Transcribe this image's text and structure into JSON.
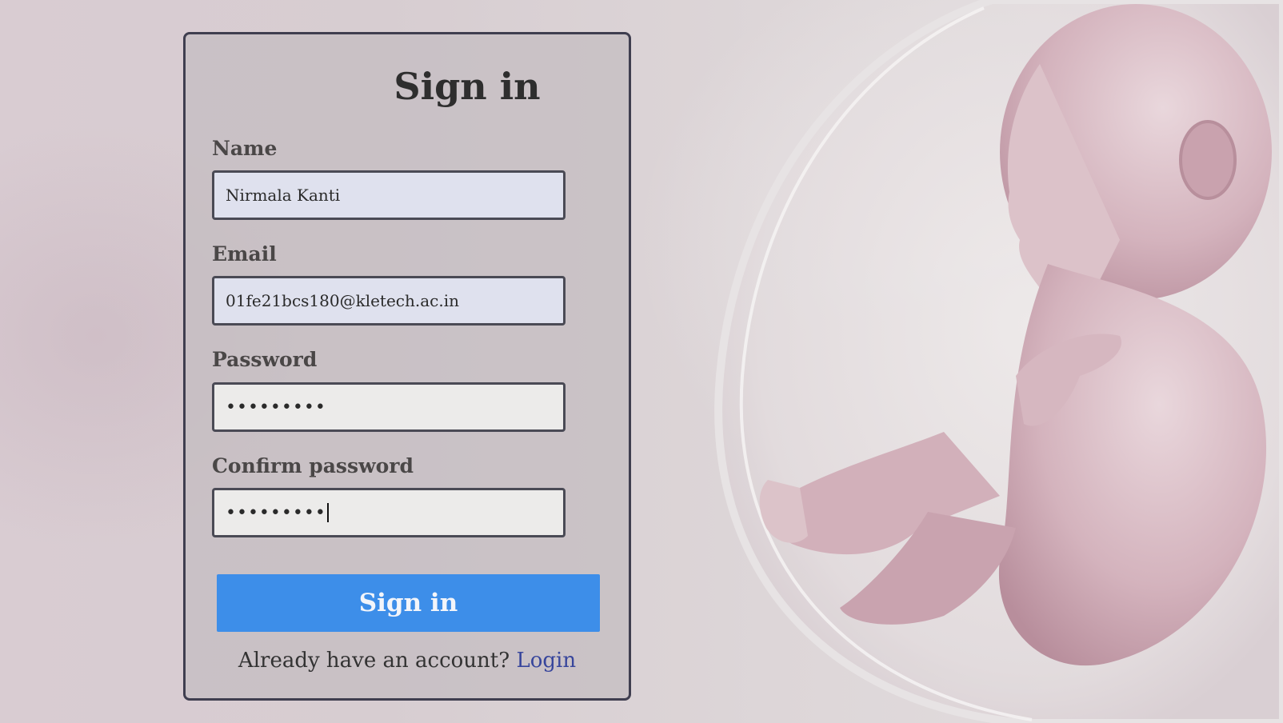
{
  "form": {
    "title": "Sign in",
    "name_label": "Name",
    "name_value": "Nirmala Kanti",
    "email_label": "Email",
    "email_value": "01fe21bcs180@kletech.ac.in",
    "password_label": "Password",
    "password_value": "•••••••••",
    "confirm_label": "Confirm password",
    "confirm_value": "•••••••••",
    "submit_label": "Sign in",
    "footer_text": "Already have an account?",
    "footer_link": "Login"
  },
  "colors": {
    "button": "#3d8ee9",
    "link": "#38469c",
    "card_border": "#3f3e4f"
  }
}
